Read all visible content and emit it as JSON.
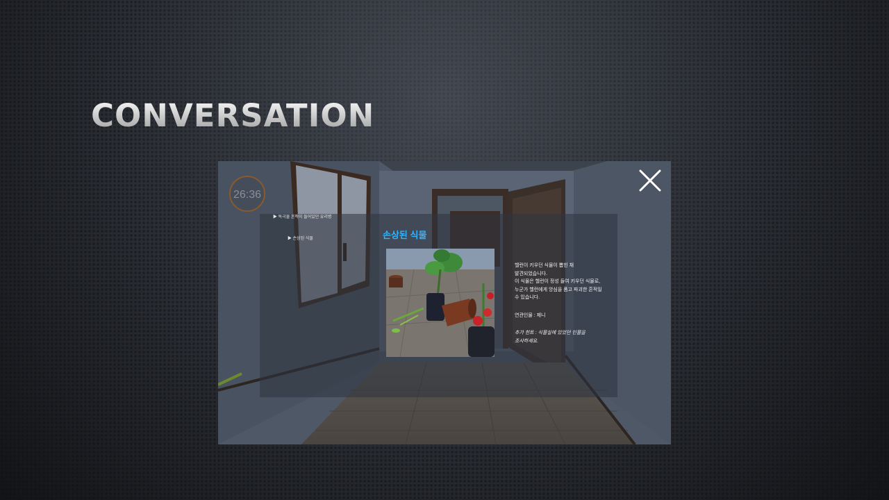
{
  "slide": {
    "title": "CONVERSATION"
  },
  "game": {
    "timer": "26:36",
    "clue_list": [
      "▶ 독극물 흔적이 들어있던 유리병",
      "▶ 손상된 식물"
    ],
    "close_icon": "close-x-icon",
    "popup": {
      "title": "손상된 식물",
      "title_color": "#2fb3ff",
      "description_lines": [
        "헬런이 키우던 식물이 뽑힌 채",
        "발견되었습니다.",
        "이 식물은 헬런이 정성 들여 키우던 식물로,",
        "누군가 헬런에게 앙심을 품고 파괴한 흔적일",
        "수 있습니다."
      ],
      "related_person": "연관인물 : 제니",
      "hint_lines": [
        "추가 힌트 : 식물실에 있었던 인물을",
        "조사하세요."
      ]
    }
  }
}
